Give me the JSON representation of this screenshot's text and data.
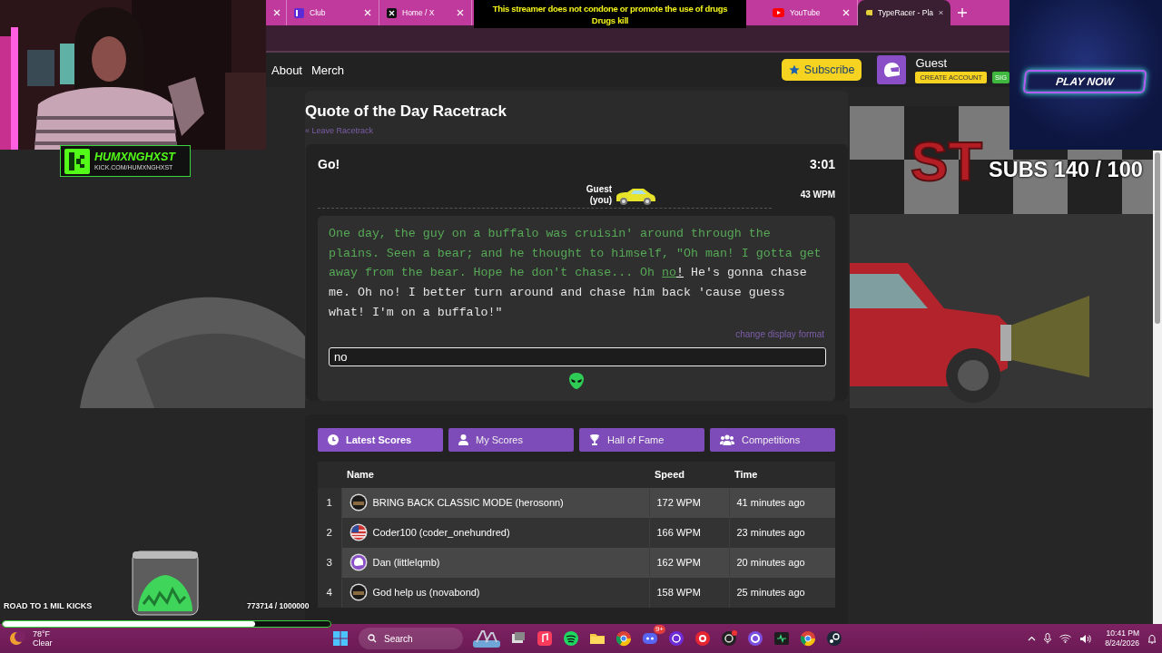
{
  "browser": {
    "tabs_left": [
      {
        "kind": "partial",
        "selected": false
      },
      {
        "kind": "tab",
        "label": "Club",
        "selected": false
      },
      {
        "kind": "tab",
        "label": "Home / X",
        "selected": false
      }
    ],
    "tabs_right": [
      {
        "kind": "tab",
        "label": "YouTube",
        "selected": false
      },
      {
        "kind": "tab",
        "label": "TypeRacer - Pla",
        "selected": true
      }
    ]
  },
  "site_nav": {
    "links": [
      "About",
      "Merch"
    ],
    "subscribe": "Subscribe",
    "user": "Guest",
    "create_account": "CREATE ACCOUNT",
    "sign": "SIG"
  },
  "race": {
    "title": "Quote of the Day Racetrack",
    "leave_link": "« Leave Racetrack",
    "status": "Go!",
    "timer": "3:01",
    "racer": {
      "name": "Guest",
      "tag": "(you)",
      "speed": "43 WPM",
      "level": 0.65
    },
    "quote": [
      {
        "kind": "typed",
        "text": "One day, the guy on a buffalo was cruisin' around through the plains. Seen a bear; and he thought to himself, \"Oh man! I gotta get away from the bear. Hope he don't chase... Oh "
      },
      {
        "kind": "current-typed",
        "text": "no"
      },
      {
        "kind": "current-untyped",
        "text": "!"
      },
      {
        "kind": "untyped",
        "text": " He's gonna chase me. Oh no! I better turn around and chase him back 'cause guess what! I'm on a buffalo!\""
      }
    ],
    "format_link": "change display format",
    "input": {
      "value": "no"
    }
  },
  "scores": {
    "tabs": [
      {
        "label": "Latest Scores",
        "selected": true
      },
      {
        "label": "My Scores",
        "selected": false
      },
      {
        "label": "Hall of Fame",
        "selected": false
      },
      {
        "label": "Competitions",
        "selected": false
      }
    ],
    "columns": [
      "Name",
      "Speed",
      "Time"
    ],
    "rows": [
      {
        "rank": "1",
        "name": "BRING BACK CLASSIC MODE (herosonn)",
        "speed": "172 WPM",
        "time": "41 minutes ago"
      },
      {
        "rank": "2",
        "kind": "flag",
        "name": "Coder100 (coder_onehundred)",
        "speed": "166 WPM",
        "time": "23 minutes ago"
      },
      {
        "rank": "3",
        "kind": "helmet",
        "name": "Dan (littlelqmb)",
        "speed": "162 WPM",
        "time": "20 minutes ago"
      },
      {
        "rank": "4",
        "name": "God help us (novabond)",
        "speed": "158 WPM",
        "time": "25 minutes ago"
      }
    ]
  },
  "art": {
    "sign": "ST"
  },
  "overlays": {
    "disclaimer": [
      "This streamer does not condone or promote the use of drugs",
      "Drugs kill"
    ],
    "channel": {
      "name": "HUMXNGHXST",
      "url": "KICK.COM/HUMXNGHXST"
    },
    "ad": {
      "button": "PLAY NOW"
    },
    "subs": "SUBS 140 / 100",
    "kicks_goal": {
      "label": "ROAD TO 1 MIL KICKS",
      "count": "773714 / 1000000",
      "level": 0.77
    }
  },
  "taskbar": {
    "weather": {
      "temp": "78°F",
      "condition": "Clear"
    },
    "search": "Search",
    "badge": "9+",
    "time": "10:41 PM",
    "date": "8/24/2026"
  }
}
